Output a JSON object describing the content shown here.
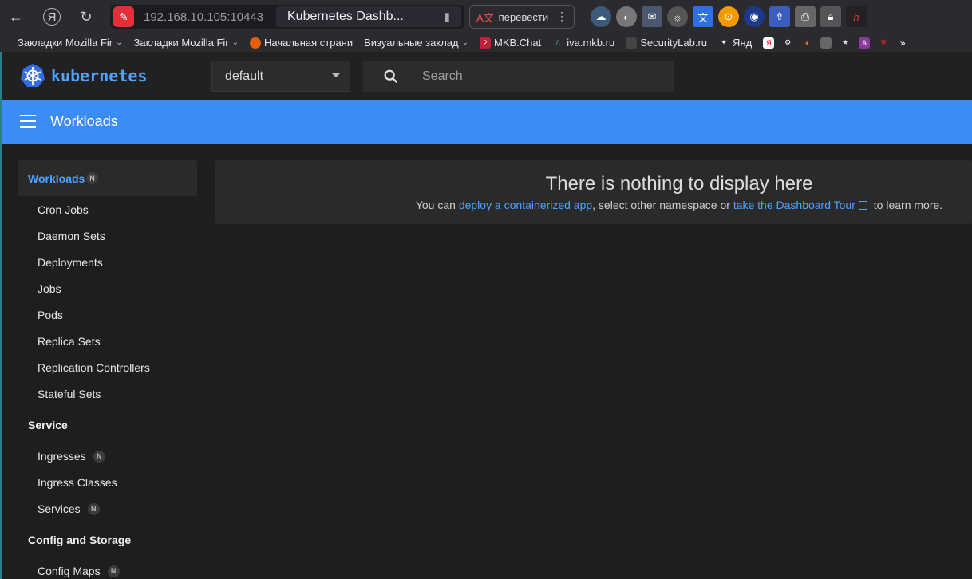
{
  "browser": {
    "url_host": "192.168.10.105:10443",
    "tab_title": "Kubernetes Dashb...",
    "translate_label": "перевести",
    "bookmarks": [
      {
        "label": "Закладки Mozilla Fir",
        "has_chevron": true
      },
      {
        "label": "Закладки Mozilla Fir",
        "has_chevron": true
      },
      {
        "label": "Начальная страни",
        "has_chevron": false
      },
      {
        "label": "Визуальные заклад",
        "has_chevron": true
      },
      {
        "label": "MKB.Chat",
        "has_chevron": false
      },
      {
        "label": "iva.mkb.ru",
        "has_chevron": false
      },
      {
        "label": "SecurityLab.ru",
        "has_chevron": false
      },
      {
        "label": "Янд",
        "has_chevron": false
      }
    ]
  },
  "header": {
    "brand": "kubernetes",
    "namespace": "default",
    "search_placeholder": "Search"
  },
  "title_bar": {
    "title": "Workloads"
  },
  "sidebar": {
    "workloads_label": "Workloads",
    "workloads_badge": "N",
    "workload_items": [
      "Cron Jobs",
      "Daemon Sets",
      "Deployments",
      "Jobs",
      "Pods",
      "Replica Sets",
      "Replication Controllers",
      "Stateful Sets"
    ],
    "service_label": "Service",
    "service_items": [
      {
        "label": "Ingresses",
        "badge": "N"
      },
      {
        "label": "Ingress Classes",
        "badge": ""
      },
      {
        "label": "Services",
        "badge": "N"
      }
    ],
    "config_label": "Config and Storage",
    "config_items": [
      {
        "label": "Config Maps",
        "badge": "N"
      }
    ]
  },
  "main": {
    "empty_title": "There is nothing to display here",
    "sub_prefix": "You can ",
    "deploy_link": "deploy a containerized app",
    "sub_middle": ", select other namespace or ",
    "tour_link": "take the Dashboard Tour",
    "sub_suffix": " to learn more."
  },
  "colors": {
    "accent": "#3b8cf5",
    "link": "#4fa3ff",
    "background": "#1e1e1e"
  }
}
